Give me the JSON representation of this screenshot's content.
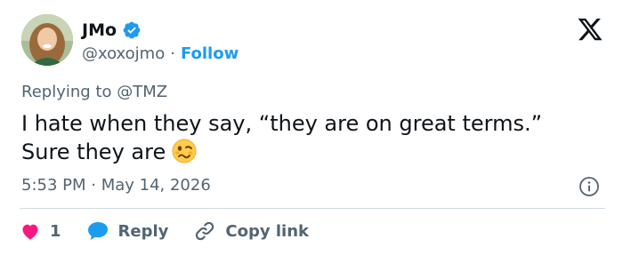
{
  "header": {
    "display_name": "JMo",
    "handle": "@xoxojmo",
    "separator": "·",
    "follow_label": "Follow"
  },
  "icons": {
    "verified": "verified-badge-icon",
    "logo": "x-logo-icon",
    "info": "info-icon",
    "like": "heart-icon",
    "reply": "reply-bubble-icon",
    "copy": "link-icon",
    "emoji": "woozy-face-emoji"
  },
  "tweet": {
    "replying_to": "Replying to @TMZ",
    "line1": "I hate when they say, “they are on great terms.”",
    "line2": "Sure they are",
    "timestamp": "5:53 PM · May 14, 2026"
  },
  "actions": {
    "like_count": "1",
    "reply_label": "Reply",
    "copy_label": "Copy link"
  },
  "colors": {
    "accent": "#1d9bf0",
    "like": "#f91880",
    "text_secondary": "#536471",
    "text_primary": "#0f1419"
  }
}
